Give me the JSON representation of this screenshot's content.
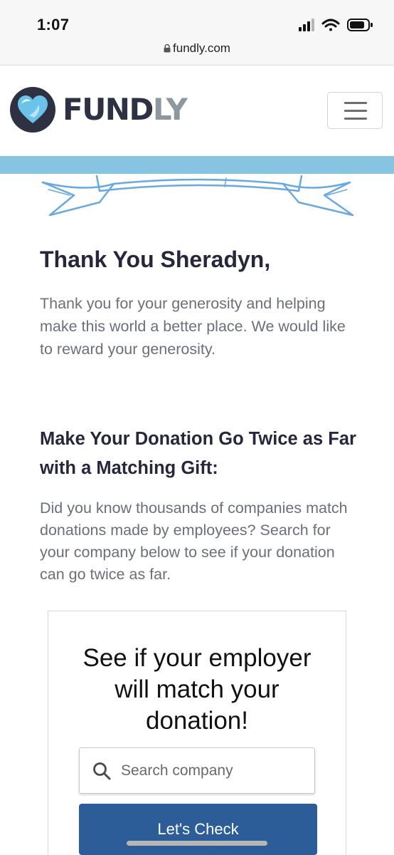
{
  "status_bar": {
    "time": "1:07",
    "icons": [
      "cellular-signal-icon",
      "wifi-icon",
      "battery-icon"
    ]
  },
  "browser": {
    "url": "fundly.com",
    "icons": [
      "lock-icon"
    ]
  },
  "header": {
    "logo_primary": "FUND",
    "logo_secondary": "LY",
    "icons": [
      "heart-logo-icon",
      "hamburger-menu-icon"
    ]
  },
  "content": {
    "thank_title": "Thank You Sheradyn,",
    "thank_body": "Thank you for your generosity and helping make this world a better place. We would like to reward your generosity.",
    "match_heading": "Make Your Donation Go Twice as Far with a Matching Gift:",
    "match_body": "Did you know thousands of companies match donations made by employees? Search for your company below to see if your donation can go twice as far."
  },
  "widget": {
    "title": "See if your employer will match your donation!",
    "search_placeholder": "Search company",
    "search_value": "",
    "button_label": "Let's Check",
    "icons": [
      "search-icon"
    ]
  },
  "colors": {
    "brand_dark": "#2d3142",
    "brand_grey": "#8e979d",
    "accent_blue": "#86c4e1",
    "heart_blue": "#6cc3ea",
    "button_blue": "#2d5d99",
    "heading_text": "#26273d",
    "body_text": "#6b6f78"
  }
}
